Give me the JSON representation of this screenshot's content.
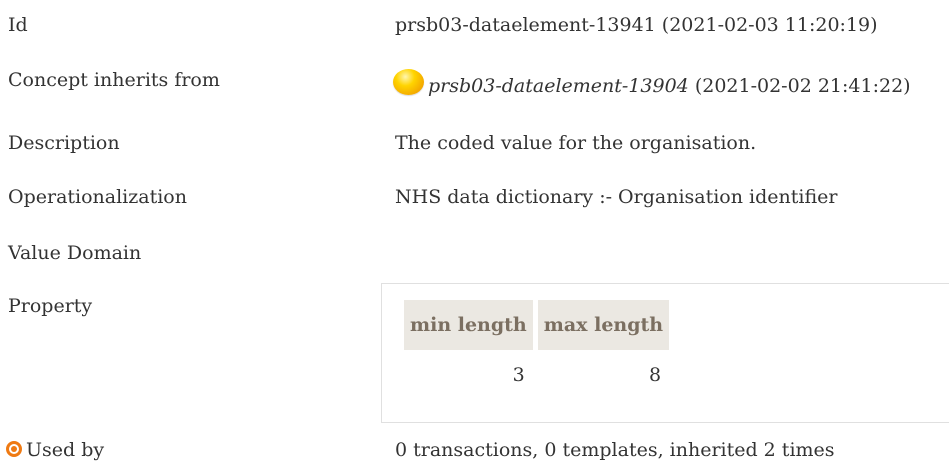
{
  "rows": {
    "id": {
      "label": "Id",
      "value": "prsb03-dataelement-13941 (2021-02-03 11:20:19)"
    },
    "inherits": {
      "label": "Concept inherits from",
      "link": "prsb03-dataelement-13904",
      "timestamp": " (2021-02-02 21:41:22)"
    },
    "description": {
      "label": "Description",
      "value": "The coded value for the organisation."
    },
    "operationalization": {
      "label": "Operationalization",
      "value": "NHS data dictionary :- Organisation identifier"
    },
    "value_domain": {
      "label": "Value Domain"
    },
    "property": {
      "label": "Property",
      "headers": [
        "min length",
        "max length"
      ],
      "values": [
        "3",
        "8"
      ]
    },
    "used_by": {
      "label": "Used by",
      "value": "0 transactions, 0 templates, inherited 2 times"
    }
  },
  "icons": {
    "status": "status-dot-icon",
    "used_by": "target-icon"
  },
  "colors": {
    "status_dot": "#ffcc00",
    "header_bg": "#ebe8e2",
    "header_text": "#7b6f61",
    "used_icon": "#ef7a13"
  }
}
